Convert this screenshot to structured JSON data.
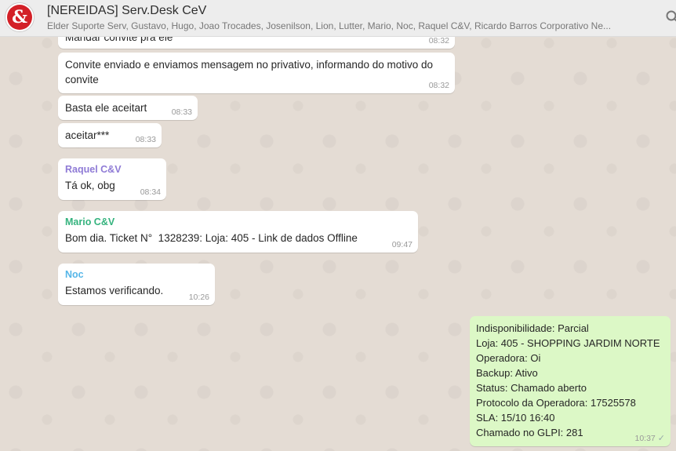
{
  "header": {
    "avatar_text": "&",
    "title": "[NEREIDAS] Serv.Desk CeV",
    "subtitle": "Elder Suporte Serv, Gustavo, Hugo, Joao Trocades, Josenilson, Lion, Lutter, Mario, Noc, Raquel C&V, Ricardo Barros Corporativo Ne..."
  },
  "messages": [
    {
      "text": "Mandar convite pra ele",
      "time": "08:32"
    },
    {
      "text": "Convite enviado e enviamos mensagem no privativo, informando do motivo do convite",
      "time": "08:32"
    },
    {
      "text": "Basta ele aceitart",
      "time": "08:33"
    },
    {
      "text": "aceitar***",
      "time": "08:33"
    },
    {
      "sender": "Raquel C&V",
      "sender_color": "#8f7bd6",
      "text": "Tá ok, obg",
      "time": "08:34"
    },
    {
      "sender": "Mario C&V",
      "sender_color": "#35b37e",
      "text": "Bom dia. Ticket N°  1328239: Loja: 405 - Link de dados Offline",
      "time": "09:47"
    },
    {
      "sender": "Noc",
      "sender_color": "#56b6e8",
      "text": "Estamos verificando.",
      "time": "10:26"
    }
  ],
  "outgoing": {
    "lines": [
      "Indisponibilidade: Parcial",
      "Loja: 405 - SHOPPING JARDIM NORTE",
      "Operadora: Oi",
      "Backup: Ativo",
      "Status: Chamado aberto",
      "Protocolo da Operadora: 17525578",
      "SLA: 15/10 16:40",
      "Chamado no GLPI: 281"
    ],
    "time": "10:37",
    "tick": "✓"
  }
}
